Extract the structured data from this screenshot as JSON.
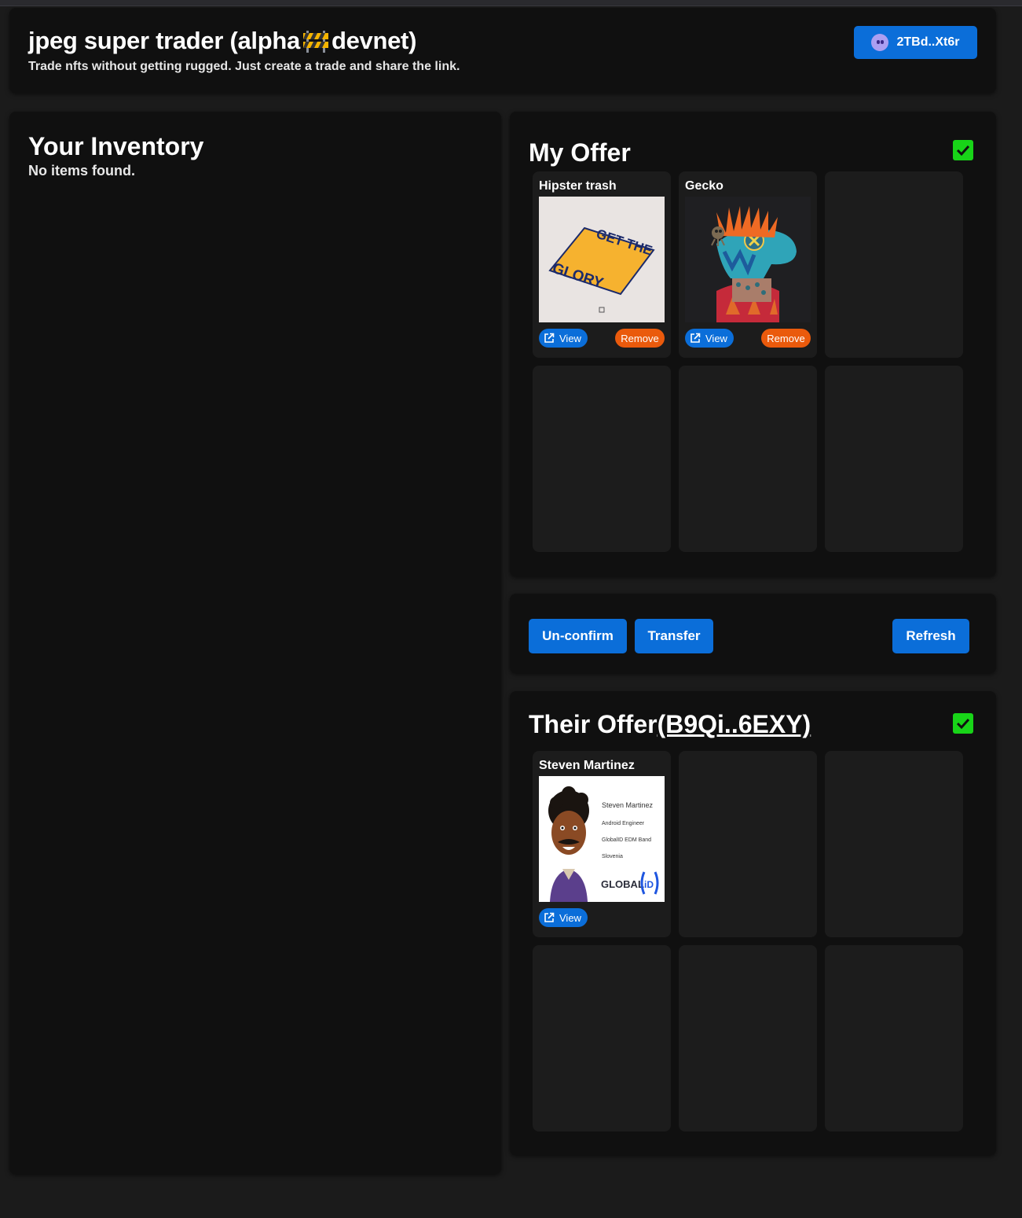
{
  "header": {
    "title_prefix": "jpeg super trader (alpha",
    "title_suffix": "devnet)",
    "subtitle": "Trade nfts without getting rugged. Just create a trade and share the link.",
    "wallet_label": "2TBd..Xt6r"
  },
  "inventory": {
    "title": "Your Inventory",
    "empty_text": "No items found."
  },
  "my_offer": {
    "title": "My Offer",
    "confirmed": true,
    "items": [
      {
        "name": "Hipster trash",
        "view_label": "View",
        "remove_label": "Remove",
        "art_text_1": "GET THE",
        "art_text_2": "GLORY"
      },
      {
        "name": "Gecko",
        "view_label": "View",
        "remove_label": "Remove"
      }
    ]
  },
  "actions": {
    "unconfirm_label": "Un-confirm",
    "transfer_label": "Transfer",
    "refresh_label": "Refresh"
  },
  "their_offer": {
    "title": "Their Offer",
    "address": "(B9Qi..6EXY)",
    "confirmed": true,
    "items": [
      {
        "name": "Steven Martinez",
        "view_label": "View",
        "card_lines": [
          "Steven Martinez",
          "Android Engineer",
          "GlobalID EDM Band",
          "Slovenia"
        ],
        "card_logo": "GLOBAL",
        "card_logo_id": "iD"
      }
    ]
  },
  "colors": {
    "accent": "#0b6ed9",
    "remove": "#ea5a0c",
    "confirm": "#18d418",
    "panel": "#101010",
    "slot": "#1c1c1c"
  },
  "icons": [
    "phantom-wallet-icon",
    "barrier-emoji-icon",
    "checkmark-icon",
    "external-link-icon"
  ]
}
